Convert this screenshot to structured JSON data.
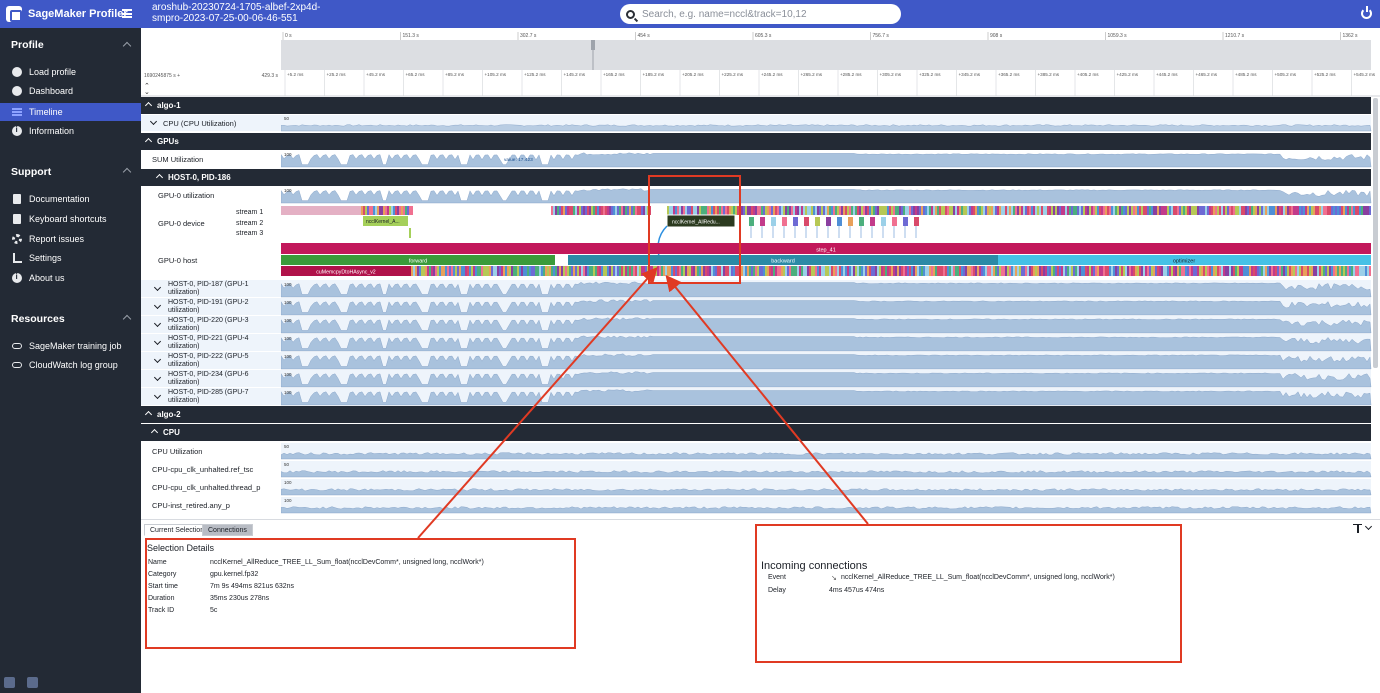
{
  "app": {
    "title": "SageMaker Profiler"
  },
  "trace": {
    "line1": "aroshub-20230724-1705-albef-2xp4d-",
    "line2": "smpro-2023-07-25-00-06-46-551"
  },
  "search": {
    "placeholder": "Search, e.g. name=nccl&track=10,12"
  },
  "sidebar": {
    "sections": [
      {
        "title": "Profile",
        "items": [
          {
            "label": "Load profile",
            "icon": "upload-icon"
          },
          {
            "label": "Dashboard",
            "icon": "gauge-icon"
          },
          {
            "label": "Timeline",
            "icon": "timeline-icon",
            "active": true
          },
          {
            "label": "Information",
            "icon": "info-icon"
          }
        ]
      },
      {
        "title": "Support",
        "items": [
          {
            "label": "Documentation",
            "icon": "doc-icon"
          },
          {
            "label": "Keyboard shortcuts",
            "icon": "keyboard-icon"
          },
          {
            "label": "Report issues",
            "icon": "bug-icon"
          },
          {
            "label": "Settings",
            "icon": "settings-icon"
          },
          {
            "label": "About us",
            "icon": "info-icon"
          }
        ]
      },
      {
        "title": "Resources",
        "items": [
          {
            "label": "SageMaker training job",
            "icon": "link-icon"
          },
          {
            "label": "CloudWatch log group",
            "icon": "link-icon"
          }
        ]
      }
    ]
  },
  "overview_axis": {
    "ticks": [
      "0 s",
      "151.3 s",
      "302.7 s",
      "454 s",
      "605.3 s",
      "756.7 s",
      "908 s",
      "1059.3 s",
      "1210.7 s",
      "1362 s"
    ]
  },
  "detail_axis": {
    "origin": "1690245875 s +",
    "offset": "429.3 s",
    "ticks": [
      "+5.2 ms",
      "+25.2 ms",
      "+45.2 ms",
      "+65.2 ms",
      "+85.2 ms",
      "+105.2 ms",
      "+125.2 ms",
      "+145.2 ms",
      "+165.2 ms",
      "+185.2 ms",
      "+205.2 ms",
      "+225.2 ms",
      "+245.2 ms",
      "+265.2 ms",
      "+285.2 ms",
      "+305.2 ms",
      "+325.2 ms",
      "+345.2 ms",
      "+365.2 ms",
      "+385.2 ms",
      "+405.2 ms",
      "+425.2 ms",
      "+445.2 ms",
      "+465.2 ms",
      "+485.2 ms",
      "+505.2 ms",
      "+525.2 ms",
      "+545.2 ms"
    ]
  },
  "tracks": {
    "algo1": "algo-1",
    "cpu_group": "CPU (CPU Utilization)",
    "gpus": "GPUs",
    "sum_util": "SUM Utilization",
    "sum_value": "value: 17.423",
    "host0": "HOST-0, PID-186",
    "gpu0_util": "GPU-0 utilization",
    "gpu0_device": "GPU-0 device",
    "streams": [
      "stream 1",
      "stream 2",
      "stream 3"
    ],
    "gpu0_host": "GPU-0 host",
    "kernel_a": "ncclKernel_A...",
    "kernel_sel": "ncclKernel_AllRedu...",
    "step": "step_41",
    "phases": [
      "forward",
      "backward",
      "optimizer"
    ],
    "memcpy": "cuMemcpyDtoHAsync_v2",
    "other_hosts": [
      "HOST-0, PID-187 (GPU-1 utilization)",
      "HOST-0, PID-191 (GPU-2 utilization)",
      "HOST-0, PID-220 (GPU-3 utilization)",
      "HOST-0, PID-221 (GPU-4 utilization)",
      "HOST-0, PID-222 (GPU-5 utilization)",
      "HOST-0, PID-234 (GPU-6 utilization)",
      "HOST-0, PID-285 (GPU-7 utilization)"
    ],
    "algo2": "algo-2",
    "cpu2": "CPU",
    "cpu_rows": [
      "CPU Utilization",
      "CPU-cpu_clk_unhalted.ref_tsc",
      "CPU-cpu_clk_unhalted.thread_p",
      "CPU-inst_retired.any_p"
    ],
    "scale_50": "50",
    "scale_100": "100"
  },
  "bottom": {
    "tabs": [
      "Current Selection",
      "Connections"
    ],
    "selection_title": "Selection Details",
    "details": [
      {
        "key": "Name",
        "value": "ncclKernel_AllReduce_TREE_LL_Sum_float(ncclDevComm*, unsigned long, ncclWork*)"
      },
      {
        "key": "Category",
        "value": "gpu.kernel.fp32"
      },
      {
        "key": "Start time",
        "value": "7m 9s 494ms 821us 632ns"
      },
      {
        "key": "Duration",
        "value": "35ms 230us 278ns"
      },
      {
        "key": "Track ID",
        "value": "5c"
      }
    ],
    "incoming_title": "Incoming connections",
    "incoming": [
      {
        "key": "Event",
        "value": "ncclKernel_AllReduce_TREE_LL_Sum_float(ncclDevComm*, unsigned long, ncclWork*)"
      },
      {
        "key": "Delay",
        "value": "4ms 457us 474ns"
      }
    ]
  },
  "colors": {
    "accent": "#3f58c7",
    "sidebar": "#232a35",
    "area": "#a9c2dd",
    "annotation": "#e03a23"
  }
}
